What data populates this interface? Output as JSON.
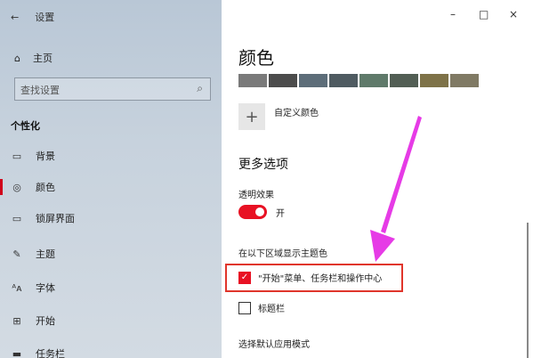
{
  "sidebar": {
    "back": "←",
    "title": "设置",
    "home": "主页",
    "search_placeholder": "查找设置",
    "group": "个性化",
    "items": [
      {
        "label": "背景",
        "icon": "image-icon"
      },
      {
        "label": "颜色",
        "icon": "palette-icon",
        "active": true
      },
      {
        "label": "锁屏界面",
        "icon": "lock-screen-icon"
      },
      {
        "label": "主题",
        "icon": "brush-icon"
      },
      {
        "label": "字体",
        "icon": "font-icon"
      },
      {
        "label": "开始",
        "icon": "start-icon"
      },
      {
        "label": "任务栏",
        "icon": "taskbar-icon"
      }
    ]
  },
  "window": {
    "minimize": "–",
    "maximize": "□",
    "close": "×"
  },
  "main": {
    "title": "颜色",
    "swatches": [
      "#7a7a7a",
      "#4c4c4c",
      "#5d6d79",
      "#4f5b61",
      "#5f7a6a",
      "#525e54",
      "#7e7248",
      "#807a64"
    ],
    "custom_color": "自定义颜色",
    "more_options": "更多选项",
    "transparency_label": "透明效果",
    "transparency_value": "开",
    "accent_surfaces_label": "在以下区域显示主题色",
    "start_taskbar_label": "\"开始\"菜单、任务栏和操作中心",
    "title_bar_label": "标题栏",
    "app_mode_label": "选择默认应用模式"
  },
  "colors": {
    "accent": "#e81123",
    "highlight": "#e0352b",
    "arrow": "#e63be6"
  }
}
